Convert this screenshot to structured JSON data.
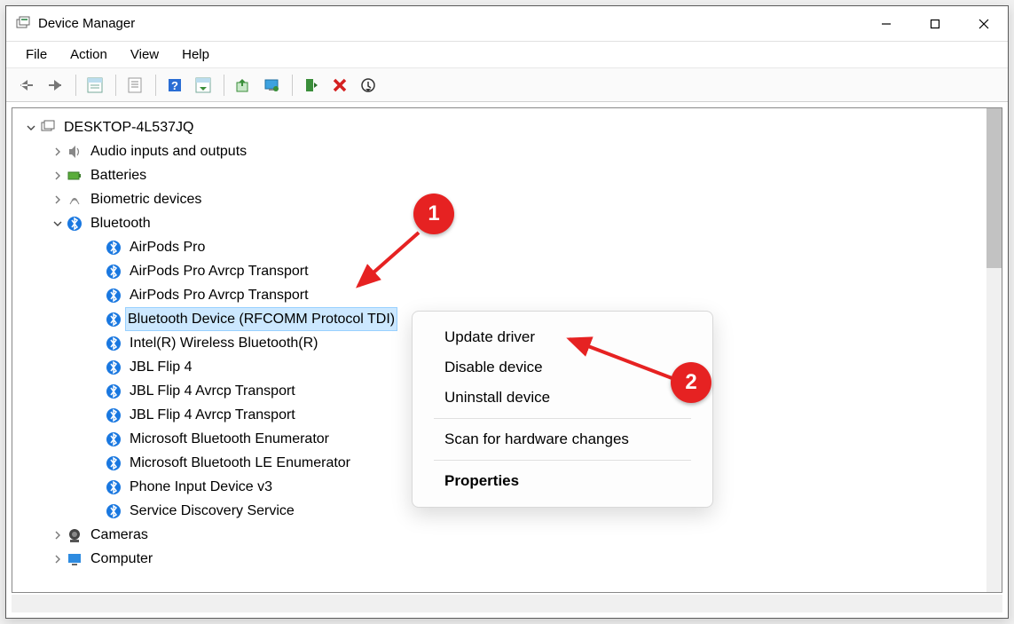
{
  "window": {
    "title": "Device Manager"
  },
  "menu": {
    "file": "File",
    "action": "Action",
    "view": "View",
    "help": "Help"
  },
  "root": {
    "label": "DESKTOP-4L537JQ"
  },
  "categories": {
    "audio": "Audio inputs and outputs",
    "batteries": "Batteries",
    "biometric": "Biometric devices",
    "bluetooth": "Bluetooth",
    "cameras": "Cameras",
    "computer": "Computer"
  },
  "bluetooth_devices": {
    "d0": "AirPods Pro",
    "d1": "AirPods Pro Avrcp Transport",
    "d2": "AirPods Pro Avrcp Transport",
    "d3": "Bluetooth Device (RFCOMM Protocol TDI)",
    "d4": "Intel(R) Wireless Bluetooth(R)",
    "d5": "JBL Flip 4",
    "d6": "JBL Flip 4 Avrcp Transport",
    "d7": "JBL Flip 4 Avrcp Transport",
    "d8": "Microsoft Bluetooth Enumerator",
    "d9": "Microsoft Bluetooth LE Enumerator",
    "d10": "Phone Input Device v3",
    "d11": "Service Discovery Service"
  },
  "context_menu": {
    "update": "Update driver",
    "disable": "Disable device",
    "uninstall": "Uninstall device",
    "scan": "Scan for hardware changes",
    "properties": "Properties"
  },
  "annotations": {
    "b1": "1",
    "b2": "2"
  }
}
